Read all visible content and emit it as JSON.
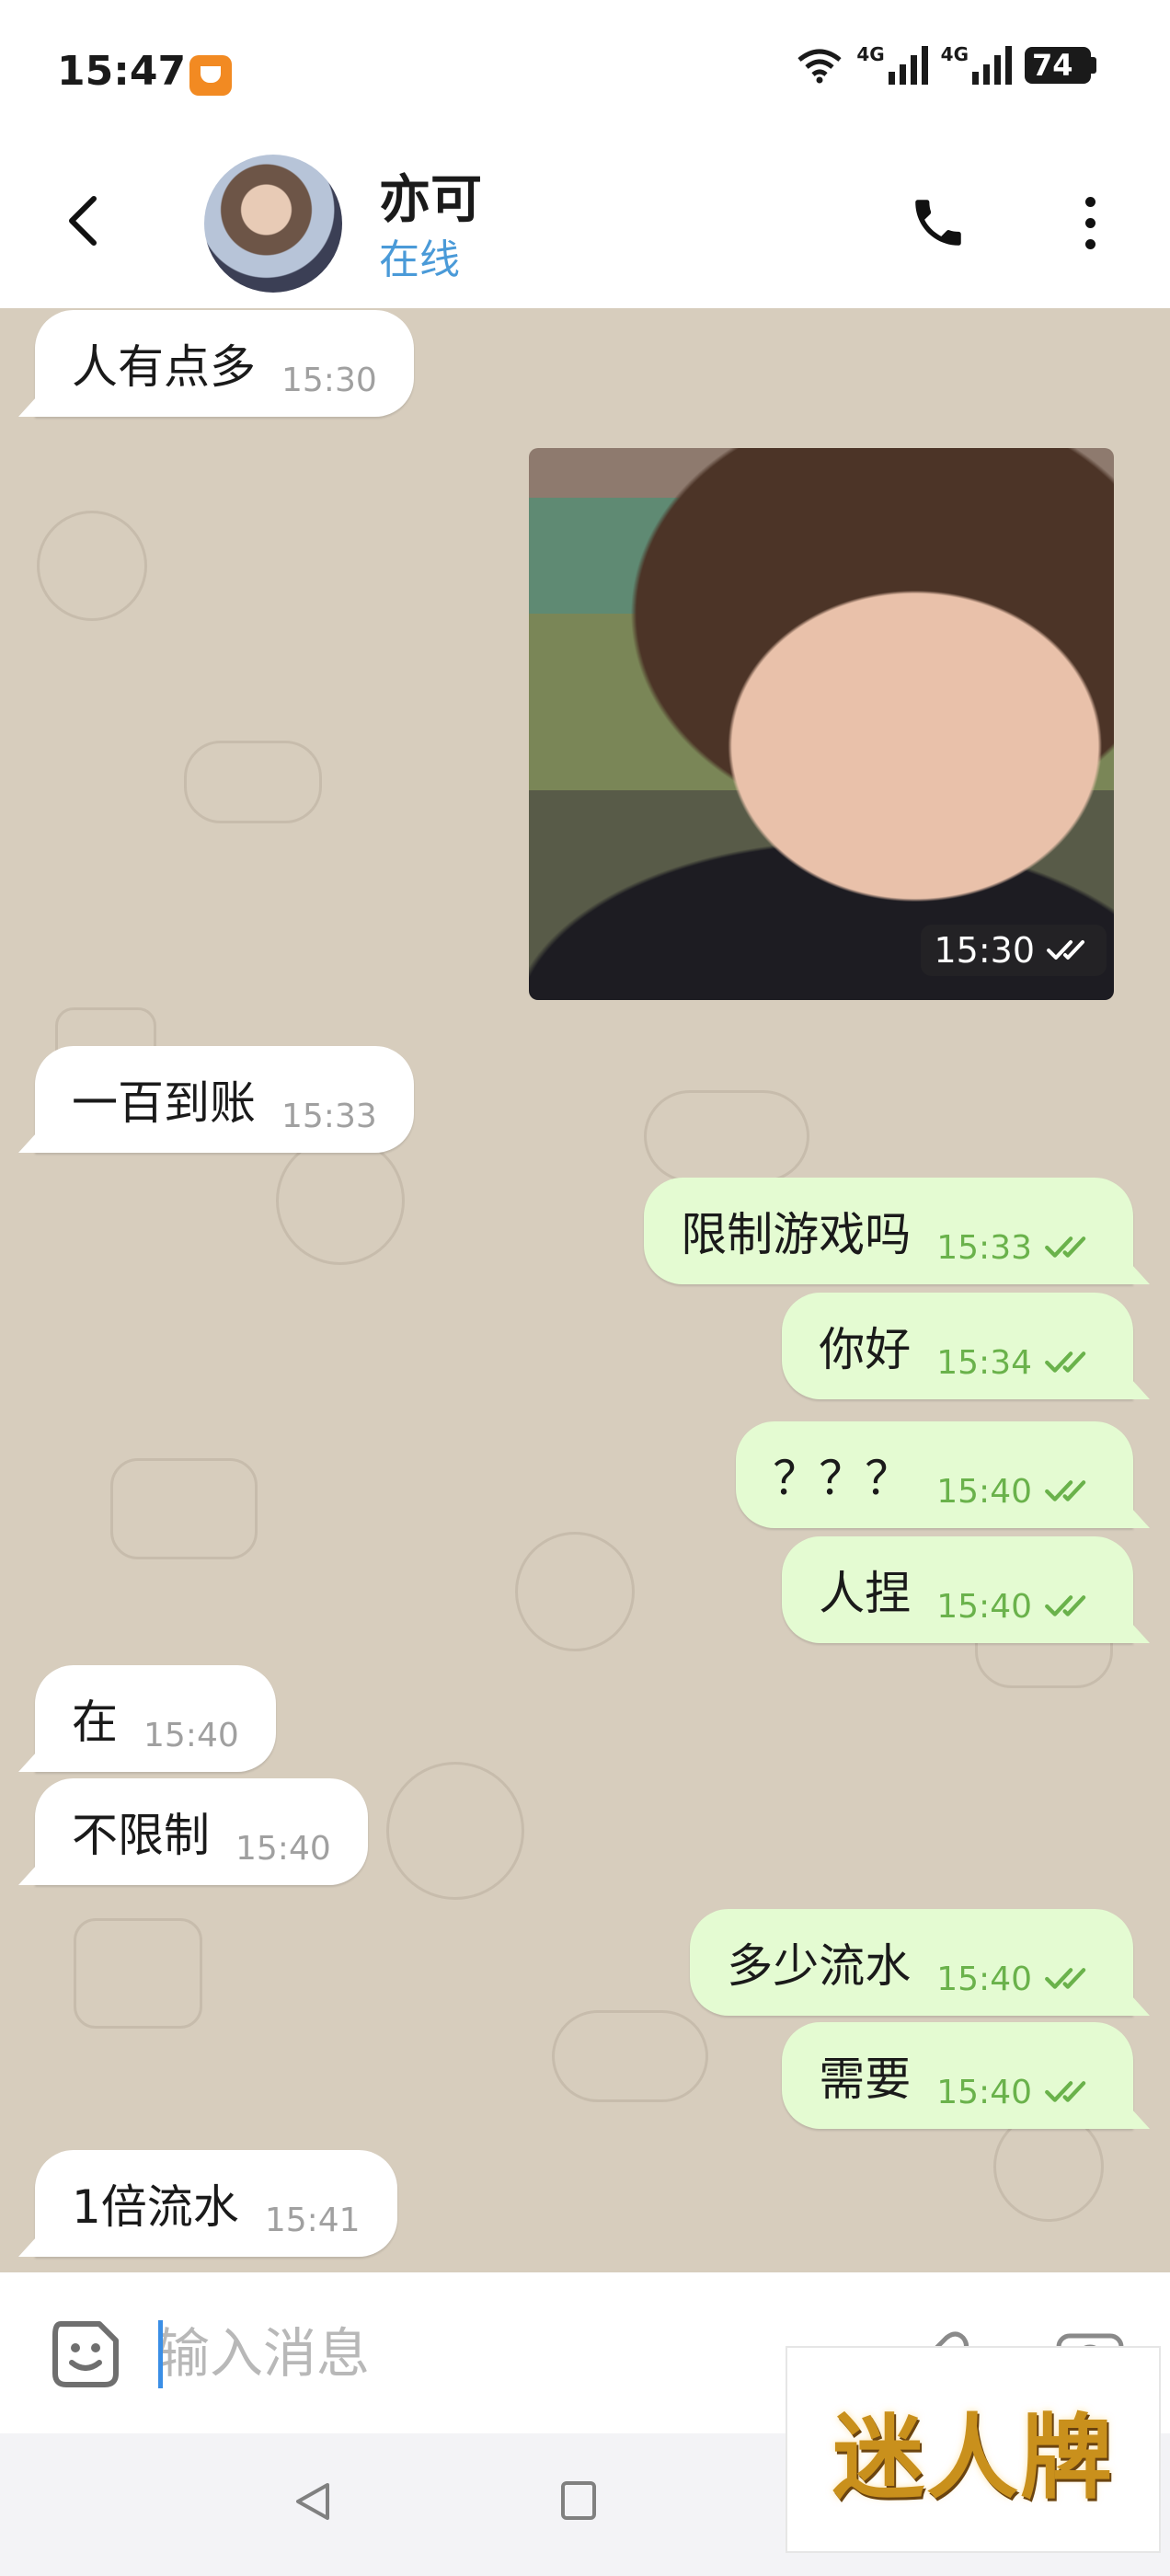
{
  "status_bar": {
    "time": "15:47",
    "network_label_1": "4G",
    "network_label_2": "4G",
    "battery": "74"
  },
  "header": {
    "contact_name": "亦可",
    "contact_status": "在线"
  },
  "messages": [
    {
      "dir": "in",
      "text": "人有点多",
      "time": "15:30"
    },
    {
      "dir": "out",
      "type": "image",
      "time": "15:30"
    },
    {
      "dir": "in",
      "text": "一百到账",
      "time": "15:33"
    },
    {
      "dir": "out",
      "text": "限制游戏吗",
      "time": "15:33"
    },
    {
      "dir": "out",
      "text": "你好",
      "time": "15:34"
    },
    {
      "dir": "out",
      "text": "？？？",
      "time": "15:40"
    },
    {
      "dir": "out",
      "text": "人捏",
      "time": "15:40"
    },
    {
      "dir": "in",
      "text": "在",
      "time": "15:40"
    },
    {
      "dir": "in",
      "text": "不限制",
      "time": "15:40"
    },
    {
      "dir": "out",
      "text": "多少流水",
      "time": "15:40"
    },
    {
      "dir": "out",
      "text": "需要",
      "time": "15:40"
    },
    {
      "dir": "in",
      "text": "1倍流水",
      "time": "15:41"
    }
  ],
  "input": {
    "placeholder": "输入消息"
  },
  "watermark": {
    "text": "迷人牌"
  },
  "colors": {
    "chat_bg": "#d7cdbd",
    "outgoing_bubble": "#e4fbd2",
    "incoming_bubble": "#ffffff",
    "status_online": "#4a9ad8",
    "read_ticks": "#6ab24b"
  },
  "icons": {
    "back": "chevron-left-icon",
    "call": "phone-icon",
    "more": "more-vertical-icon",
    "sticker": "sticker-icon",
    "attach": "paperclip-icon",
    "camera": "camera-icon"
  }
}
